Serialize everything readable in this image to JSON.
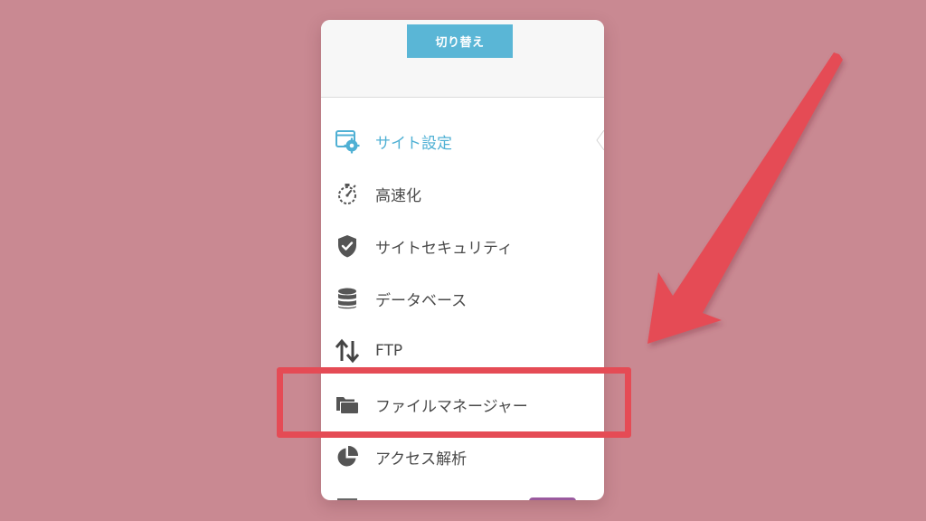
{
  "header": {
    "switch_label": "切り替え"
  },
  "menu": {
    "items": [
      {
        "label": "サイト設定",
        "icon": "site-settings-icon",
        "active": true
      },
      {
        "label": "高速化",
        "icon": "stopwatch-icon",
        "active": false
      },
      {
        "label": "サイトセキュリティ",
        "icon": "shield-check-icon",
        "active": false
      },
      {
        "label": "データベース",
        "icon": "database-icon",
        "active": false
      },
      {
        "label": "FTP",
        "icon": "transfer-arrows-icon",
        "active": false
      },
      {
        "label": "ファイルマネージャー",
        "icon": "folder-icon",
        "active": false
      },
      {
        "label": "アクセス解析",
        "icon": "pie-chart-icon",
        "active": false
      }
    ]
  },
  "colors": {
    "background": "#c98992",
    "accent": "#5ab6d6",
    "active_text": "#4fb0d4",
    "highlight": "#e54b55",
    "text": "#4a4a4a"
  }
}
